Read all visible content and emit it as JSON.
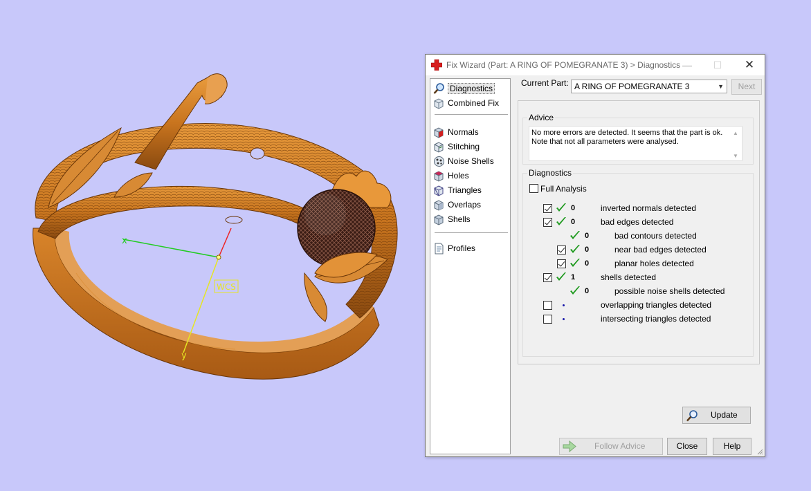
{
  "viewport": {
    "axis_labels": {
      "x": "x",
      "y": "y"
    },
    "wcs_label": "WCS",
    "ring_color": "#c8741e",
    "background": "#c8c8fa"
  },
  "dialog": {
    "title": "Fix Wizard (Part: A RING OF POMEGRANATE 3) > Diagnostics",
    "title_icon": "red-cross-icon",
    "controls": {
      "minimize": "—",
      "maximize": "☐",
      "close": "✕"
    }
  },
  "nav": {
    "groups": [
      [
        {
          "label": "Diagnostics",
          "icon": "magnifier-icon",
          "selected": true
        },
        {
          "label": "Combined Fix",
          "icon": "cube-stack-icon"
        }
      ],
      [
        {
          "label": "Normals",
          "icon": "normals-cube-icon"
        },
        {
          "label": "Stitching",
          "icon": "stitching-cube-icon"
        },
        {
          "label": "Noise Shells",
          "icon": "noise-shells-icon"
        },
        {
          "label": "Holes",
          "icon": "holes-cube-icon"
        },
        {
          "label": "Triangles",
          "icon": "triangles-cube-icon"
        },
        {
          "label": "Overlaps",
          "icon": "overlaps-cube-icon"
        },
        {
          "label": "Shells",
          "icon": "shells-cube-icon"
        }
      ],
      [
        {
          "label": "Profiles",
          "icon": "profiles-document-icon"
        }
      ]
    ]
  },
  "current_part": {
    "label": "Current Part:",
    "value": "A RING OF POMEGRANATE 3",
    "next_label": "Next"
  },
  "advice": {
    "title": "Advice",
    "text": "No more errors are detected. It seems that the part is ok. Note that not all parameters were analysed."
  },
  "diagnostics": {
    "title": "Diagnostics",
    "full_analysis_label": "Full Analysis",
    "full_analysis_checked": false,
    "rows": [
      {
        "checkbox": true,
        "checked": true,
        "status": "ok",
        "count": "0",
        "label": "inverted normals detected",
        "indent": 0
      },
      {
        "checkbox": true,
        "checked": true,
        "status": "ok",
        "count": "0",
        "label": "bad edges detected",
        "indent": 0
      },
      {
        "checkbox": false,
        "checked": false,
        "status": "ok",
        "count": "0",
        "label": "bad contours detected",
        "indent": 1
      },
      {
        "checkbox": true,
        "checked": true,
        "status": "ok",
        "count": "0",
        "label": "near bad edges detected",
        "indent": 1
      },
      {
        "checkbox": true,
        "checked": true,
        "status": "ok",
        "count": "0",
        "label": "planar holes detected",
        "indent": 1
      },
      {
        "checkbox": true,
        "checked": true,
        "status": "ok",
        "count": "1",
        "label": "shells detected",
        "indent": 0
      },
      {
        "checkbox": false,
        "checked": false,
        "status": "ok",
        "count": "0",
        "label": "possible noise shells detected",
        "indent": 1
      },
      {
        "checkbox": true,
        "checked": false,
        "status": "none",
        "count": "",
        "label": "overlapping triangles detected",
        "indent": 0
      },
      {
        "checkbox": true,
        "checked": false,
        "status": "none",
        "count": "",
        "label": "intersecting triangles detected",
        "indent": 0
      }
    ],
    "update_label": "Update"
  },
  "footer": {
    "follow_advice_label": "Follow Advice",
    "follow_advice_enabled": false,
    "close_label": "Close",
    "help_label": "Help"
  },
  "colors": {
    "check_green": "#1f9a1f",
    "dot_blue": "#1a1aaa"
  }
}
